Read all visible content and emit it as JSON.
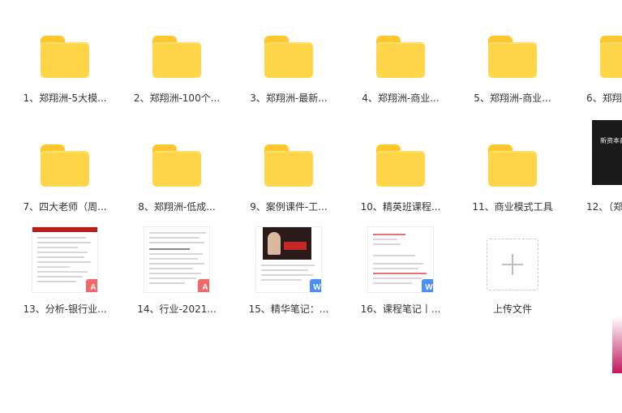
{
  "files": [
    {
      "label": "1、郑翔洲-5大模...",
      "kind": "folder"
    },
    {
      "label": "2、郑翔洲-100个...",
      "kind": "folder"
    },
    {
      "label": "3、郑翔洲-最新...",
      "kind": "folder"
    },
    {
      "label": "4、郑翔洲-商业...",
      "kind": "folder"
    },
    {
      "label": "5、郑翔洲-商业...",
      "kind": "folder"
    },
    {
      "label": "6、郑翔",
      "kind": "folder"
    },
    {
      "label": "7、四大老师（周...",
      "kind": "folder"
    },
    {
      "label": "8、郑翔洲-低成...",
      "kind": "folder"
    },
    {
      "label": "9、案例课件-工...",
      "kind": "folder"
    },
    {
      "label": "10、精英班课程...",
      "kind": "folder"
    },
    {
      "label": "11、商业模式工具",
      "kind": "folder"
    },
    {
      "label": "12、（郑",
      "kind": "video",
      "thumb_text": "新资本商"
    },
    {
      "label": "13、分析-银行业...",
      "kind": "pdf"
    },
    {
      "label": "14、行业-2021...",
      "kind": "pdf"
    },
    {
      "label": "15、精华笔记：...",
      "kind": "word"
    },
    {
      "label": "16、课程笔记丨...",
      "kind": "word"
    }
  ],
  "upload": {
    "label": "上传文件"
  },
  "badges": {
    "pdf": "A",
    "word": "W"
  },
  "colors": {
    "folder": "#FFD54A",
    "pdf_badge": "#F2696A",
    "word_badge": "#4D8DF7"
  }
}
